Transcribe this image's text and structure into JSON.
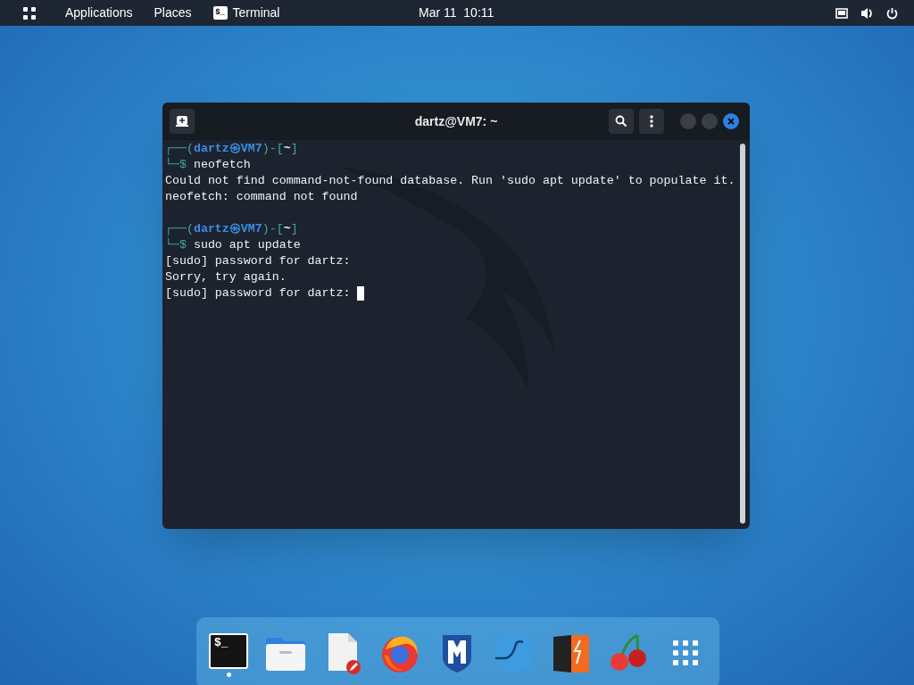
{
  "top_bar": {
    "menus": [
      "Applications",
      "Places"
    ],
    "active_app": {
      "icon_text": "$_",
      "label": "Terminal"
    },
    "clock": "Mar 11  10:11"
  },
  "window": {
    "title": "dartz@VM7: ~",
    "lines": [
      {
        "segments": [
          {
            "kind": "frame",
            "text": "┌──("
          },
          {
            "kind": "user",
            "text": "dartz㉿VM7"
          },
          {
            "kind": "frame",
            "text": ")-["
          },
          {
            "kind": "path",
            "text": "~"
          },
          {
            "kind": "frame",
            "text": "]"
          }
        ]
      },
      {
        "segments": [
          {
            "kind": "frame",
            "text": "└─$ "
          },
          {
            "kind": "plain",
            "text": "neofetch"
          }
        ]
      },
      {
        "segments": [
          {
            "kind": "plain",
            "text": "Could not find command-not-found database. Run 'sudo apt update' to populate it."
          }
        ]
      },
      {
        "segments": [
          {
            "kind": "plain",
            "text": "neofetch: command not found"
          }
        ]
      },
      {
        "kind": "blank"
      },
      {
        "segments": [
          {
            "kind": "frame",
            "text": "┌──("
          },
          {
            "kind": "user",
            "text": "dartz㉿VM7"
          },
          {
            "kind": "frame",
            "text": ")-["
          },
          {
            "kind": "path",
            "text": "~"
          },
          {
            "kind": "frame",
            "text": "]"
          }
        ]
      },
      {
        "segments": [
          {
            "kind": "frame",
            "text": "└─$ "
          },
          {
            "kind": "plain",
            "text": "sudo apt update"
          }
        ]
      },
      {
        "segments": [
          {
            "kind": "plain",
            "text": "[sudo] password for dartz:"
          }
        ]
      },
      {
        "segments": [
          {
            "kind": "plain",
            "text": "Sorry, try again."
          }
        ]
      },
      {
        "segments": [
          {
            "kind": "plain",
            "text": "[sudo] password for dartz: "
          }
        ],
        "cursor": true
      }
    ]
  },
  "dock": [
    {
      "kind": "terminal",
      "icon_text": "$_",
      "running": true
    },
    {
      "kind": "files",
      "running": false
    },
    {
      "kind": "editor",
      "running": false
    },
    {
      "kind": "firefox",
      "running": false
    },
    {
      "kind": "metasploit",
      "running": false
    },
    {
      "kind": "wireshark",
      "running": false
    },
    {
      "kind": "burp",
      "running": false
    },
    {
      "kind": "cherrytree",
      "running": false
    },
    {
      "kind": "grid",
      "running": false
    }
  ]
}
